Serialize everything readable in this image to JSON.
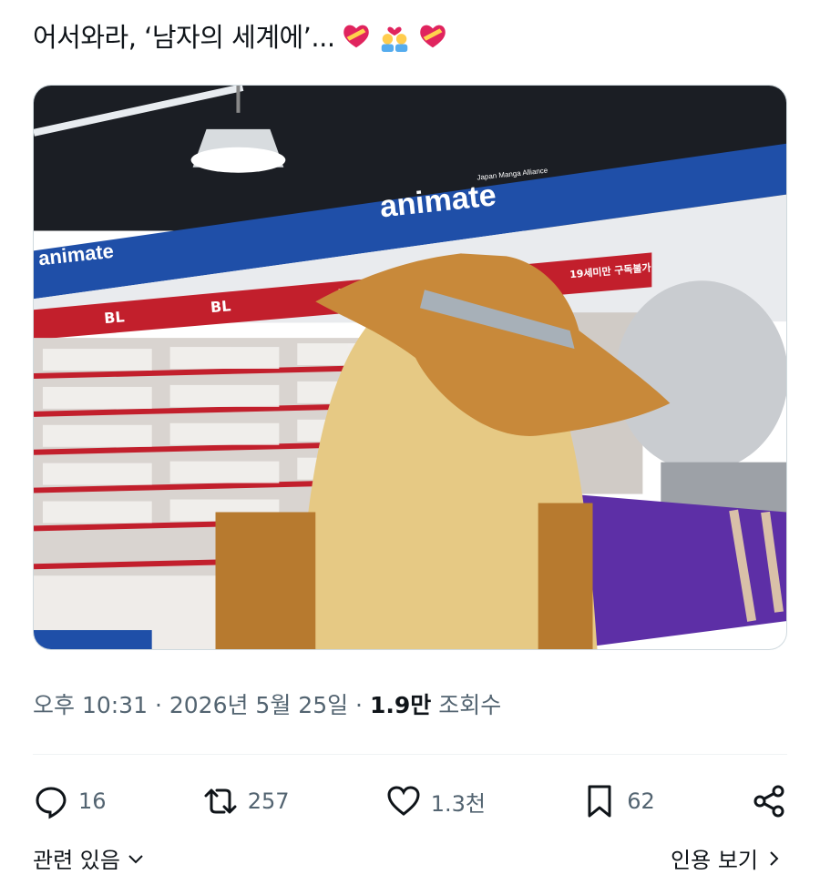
{
  "tweet": {
    "text": "어서와라, ‘남자의 세계에’...",
    "emojis": [
      "heart-with-ribbon-icon",
      "couple-with-heart-icon",
      "heart-with-ribbon-icon"
    ]
  },
  "photo": {
    "store_sign": "animate",
    "store_tagline": "Japan Manga Alliance",
    "shelf_labels": [
      "BL",
      "19세미만 구독불가"
    ]
  },
  "meta": {
    "time": "오후 10:31",
    "sep": "·",
    "date": "2026년 5월 25일",
    "views_count": "1.9만",
    "views_label": "조회수"
  },
  "actions": {
    "replies": "16",
    "retweets": "257",
    "likes": "1.3천",
    "bookmarks": "62"
  },
  "footer": {
    "related": "관련 있음",
    "more": "인용 보기"
  },
  "colors": {
    "secondary_text": "#536471",
    "primary_text": "#0f1419",
    "sign_blue": "#1f4fa8",
    "shelf_red": "#c21f2c"
  }
}
